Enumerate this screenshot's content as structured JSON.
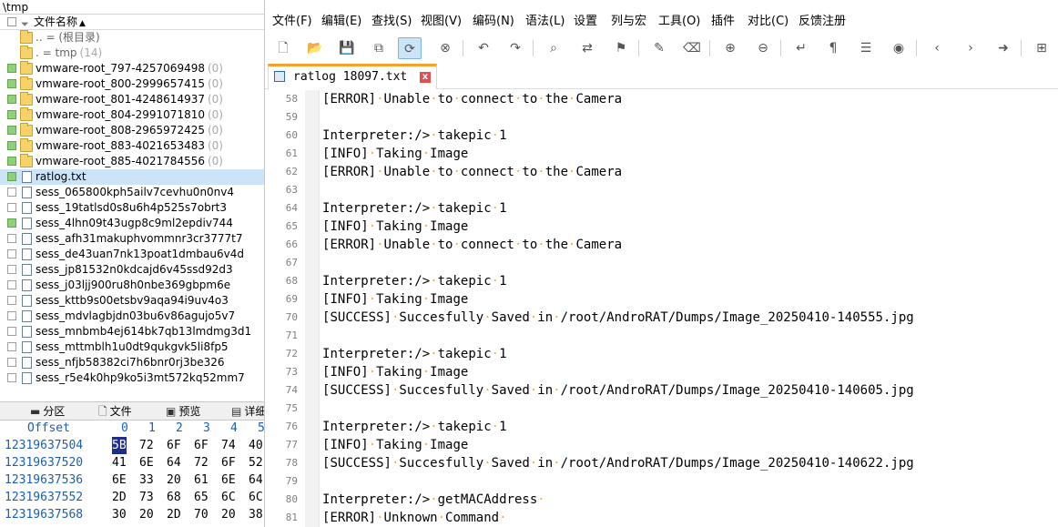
{
  "left_panel": {
    "path": "\\tmp",
    "header_label": "文件名称",
    "rows": [
      {
        "type": "meta",
        "name": "..  =   (根目录)",
        "count": "",
        "check": "none"
      },
      {
        "type": "meta",
        "name": ".   =   tmp",
        "count": "(14)",
        "check": "none"
      },
      {
        "type": "folder",
        "name": "vmware-root_797-4257069498",
        "count": "(0)",
        "check": "green"
      },
      {
        "type": "folder",
        "name": "vmware-root_800-2999657415",
        "count": "(0)",
        "check": "green"
      },
      {
        "type": "folder",
        "name": "vmware-root_801-4248614937",
        "count": "(0)",
        "check": "green"
      },
      {
        "type": "folder",
        "name": "vmware-root_804-2991071810",
        "count": "(0)",
        "check": "green"
      },
      {
        "type": "folder",
        "name": "vmware-root_808-2965972425",
        "count": "(0)",
        "check": "green"
      },
      {
        "type": "folder",
        "name": "vmware-root_883-4021653483",
        "count": "(0)",
        "check": "green"
      },
      {
        "type": "folder",
        "name": "vmware-root_885-4021784556",
        "count": "(0)",
        "check": "green"
      },
      {
        "type": "file",
        "name": "ratlog.txt",
        "count": "",
        "check": "green",
        "selected": true
      },
      {
        "type": "file",
        "name": "sess_065800kph5ailv7cevhu0n0nv4",
        "count": "",
        "check": "empty"
      },
      {
        "type": "file",
        "name": "sess_19tatlsd0s8u6h4p525s7obrt3",
        "count": "",
        "check": "empty"
      },
      {
        "type": "file",
        "name": "sess_4lhn09t43ugp8c9ml2epdiv744",
        "count": "",
        "check": "green"
      },
      {
        "type": "file",
        "name": "sess_afh31makuphvommnr3cr3777t7",
        "count": "",
        "check": "empty"
      },
      {
        "type": "file",
        "name": "sess_de43uan7nk13poat1dmbau6v4d",
        "count": "",
        "check": "empty"
      },
      {
        "type": "file",
        "name": "sess_jp81532n0kdcajd6v45ssd92d3",
        "count": "",
        "check": "empty"
      },
      {
        "type": "file",
        "name": "sess_j03ljj900ru8h0nbe369gbpm6e",
        "count": "",
        "check": "empty"
      },
      {
        "type": "file",
        "name": "sess_kttb9s00etsbv9aqa94i9uv4o3",
        "count": "",
        "check": "empty"
      },
      {
        "type": "file",
        "name": "sess_mdvlagbjdn03bu6v86agujo5v7",
        "count": "",
        "check": "empty"
      },
      {
        "type": "file",
        "name": "sess_mnbmb4ej614bk7qb13lmdmg3d1",
        "count": "",
        "check": "empty"
      },
      {
        "type": "file",
        "name": "sess_mttmblh1u0dt9qukgvk5li8fp5",
        "count": "",
        "check": "empty"
      },
      {
        "type": "file",
        "name": "sess_nfjb58382ci7h6bnr0rj3be326",
        "count": "",
        "check": "empty"
      },
      {
        "type": "file",
        "name": "sess_r5e4k0hp9ko5i3mt572kq52mm7",
        "count": "",
        "check": "empty"
      }
    ],
    "bottom_tabs": [
      {
        "label": "分区",
        "icon": "partition-icon"
      },
      {
        "label": "文件",
        "icon": "file-icon"
      },
      {
        "label": "预览",
        "icon": "preview-icon"
      },
      {
        "label": "详细",
        "icon": "details-icon"
      }
    ],
    "hex": {
      "header_label": "Offset",
      "columns": [
        "0",
        "1",
        "2",
        "3",
        "4",
        "5"
      ],
      "rows": [
        {
          "offset": "12319637504",
          "bytes": [
            "5B",
            "72",
            "6F",
            "6F",
            "74",
            "40"
          ]
        },
        {
          "offset": "12319637520",
          "bytes": [
            "41",
            "6E",
            "64",
            "72",
            "6F",
            "52"
          ]
        },
        {
          "offset": "12319637536",
          "bytes": [
            "6E",
            "33",
            "20",
            "61",
            "6E",
            "64"
          ]
        },
        {
          "offset": "12319637552",
          "bytes": [
            "2D",
            "73",
            "68",
            "65",
            "6C",
            "6C"
          ]
        },
        {
          "offset": "12319637568",
          "bytes": [
            "30",
            "20",
            "2D",
            "70",
            "20",
            "38"
          ]
        }
      ]
    }
  },
  "menu": [
    "文件(F)",
    "编辑(E)",
    "查找(S)",
    "视图(V)",
    "编码(N)",
    "语法(L)",
    "设置",
    "列与宏",
    "工具(O)",
    "插件",
    "对比(C)",
    "反馈注册"
  ],
  "tab": {
    "name": "ratlog 18097.txt",
    "close": "x"
  },
  "editor": {
    "lines": [
      {
        "n": "58",
        "text": "[ERROR] Unable to connect to the Camera"
      },
      {
        "n": "59",
        "text": ""
      },
      {
        "n": "60",
        "text": "Interpreter:/> takepic 1"
      },
      {
        "n": "61",
        "text": "[INFO] Taking Image"
      },
      {
        "n": "62",
        "text": "[ERROR] Unable to connect to the Camera"
      },
      {
        "n": "63",
        "text": ""
      },
      {
        "n": "64",
        "text": "Interpreter:/> takepic 1"
      },
      {
        "n": "65",
        "text": "[INFO] Taking Image"
      },
      {
        "n": "66",
        "text": "[ERROR] Unable to connect to the Camera"
      },
      {
        "n": "67",
        "text": ""
      },
      {
        "n": "68",
        "text": "Interpreter:/> takepic 1"
      },
      {
        "n": "69",
        "text": "[INFO] Taking Image"
      },
      {
        "n": "70",
        "text": "[SUCCESS] Succesfully Saved in /root/AndroRAT/Dumps/Image_20250410-140555.jpg"
      },
      {
        "n": "71",
        "text": ""
      },
      {
        "n": "72",
        "text": "Interpreter:/> takepic 1"
      },
      {
        "n": "73",
        "text": "[INFO] Taking Image"
      },
      {
        "n": "74",
        "text": "[SUCCESS] Succesfully Saved in /root/AndroRAT/Dumps/Image_20250410-140605.jpg"
      },
      {
        "n": "75",
        "text": ""
      },
      {
        "n": "76",
        "text": "Interpreter:/> takepic 1"
      },
      {
        "n": "77",
        "text": "[INFO] Taking Image"
      },
      {
        "n": "78",
        "text": "[SUCCESS] Succesfully Saved in /root/AndroRAT/Dumps/Image_20250410-140622.jpg"
      },
      {
        "n": "79",
        "text": ""
      },
      {
        "n": "80",
        "text": "Interpreter:/> getMACAddress "
      },
      {
        "n": "81",
        "text": "[ERROR] Unknown Command "
      }
    ]
  },
  "colors": {
    "tab_accent": "#f7a02e",
    "selection": "#cce4f7",
    "hex_offset": "#1a5fb4",
    "whitespace_dot": "#f0b040"
  }
}
